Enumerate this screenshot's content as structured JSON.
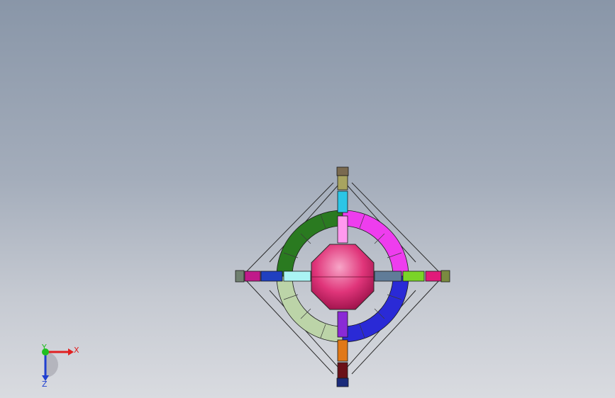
{
  "viewport": {
    "background_top": "#8996a8",
    "background_bottom": "#d9dbe0"
  },
  "model": {
    "hub_color": "#e0357a",
    "ring_quadrant_colors": {
      "top_left": "#2a7a20",
      "top_right": "#ee3dee",
      "bottom_left": "#bcd4a8",
      "bottom_right": "#2a2ad6"
    },
    "arm_segment_colors": {
      "top": [
        "#7a6a50",
        "#a8a460",
        "#2cc6e6",
        "#ff99ee"
      ],
      "bottom": [
        "#8a2ad6",
        "#e07818",
        "#6a1018",
        "#1a2a7a"
      ],
      "left": [
        "#708070",
        "#c01a8a",
        "#2040c0",
        "#aaf4f4"
      ],
      "right": [
        "#607c98",
        "#7ad428",
        "#e01a7a",
        "#7a8a40"
      ]
    }
  },
  "triad": {
    "x_label": "X",
    "y_label": "Y",
    "z_label": "Z",
    "x_color": "#e02020",
    "y_color": "#20c020",
    "z_color": "#2040d0"
  }
}
